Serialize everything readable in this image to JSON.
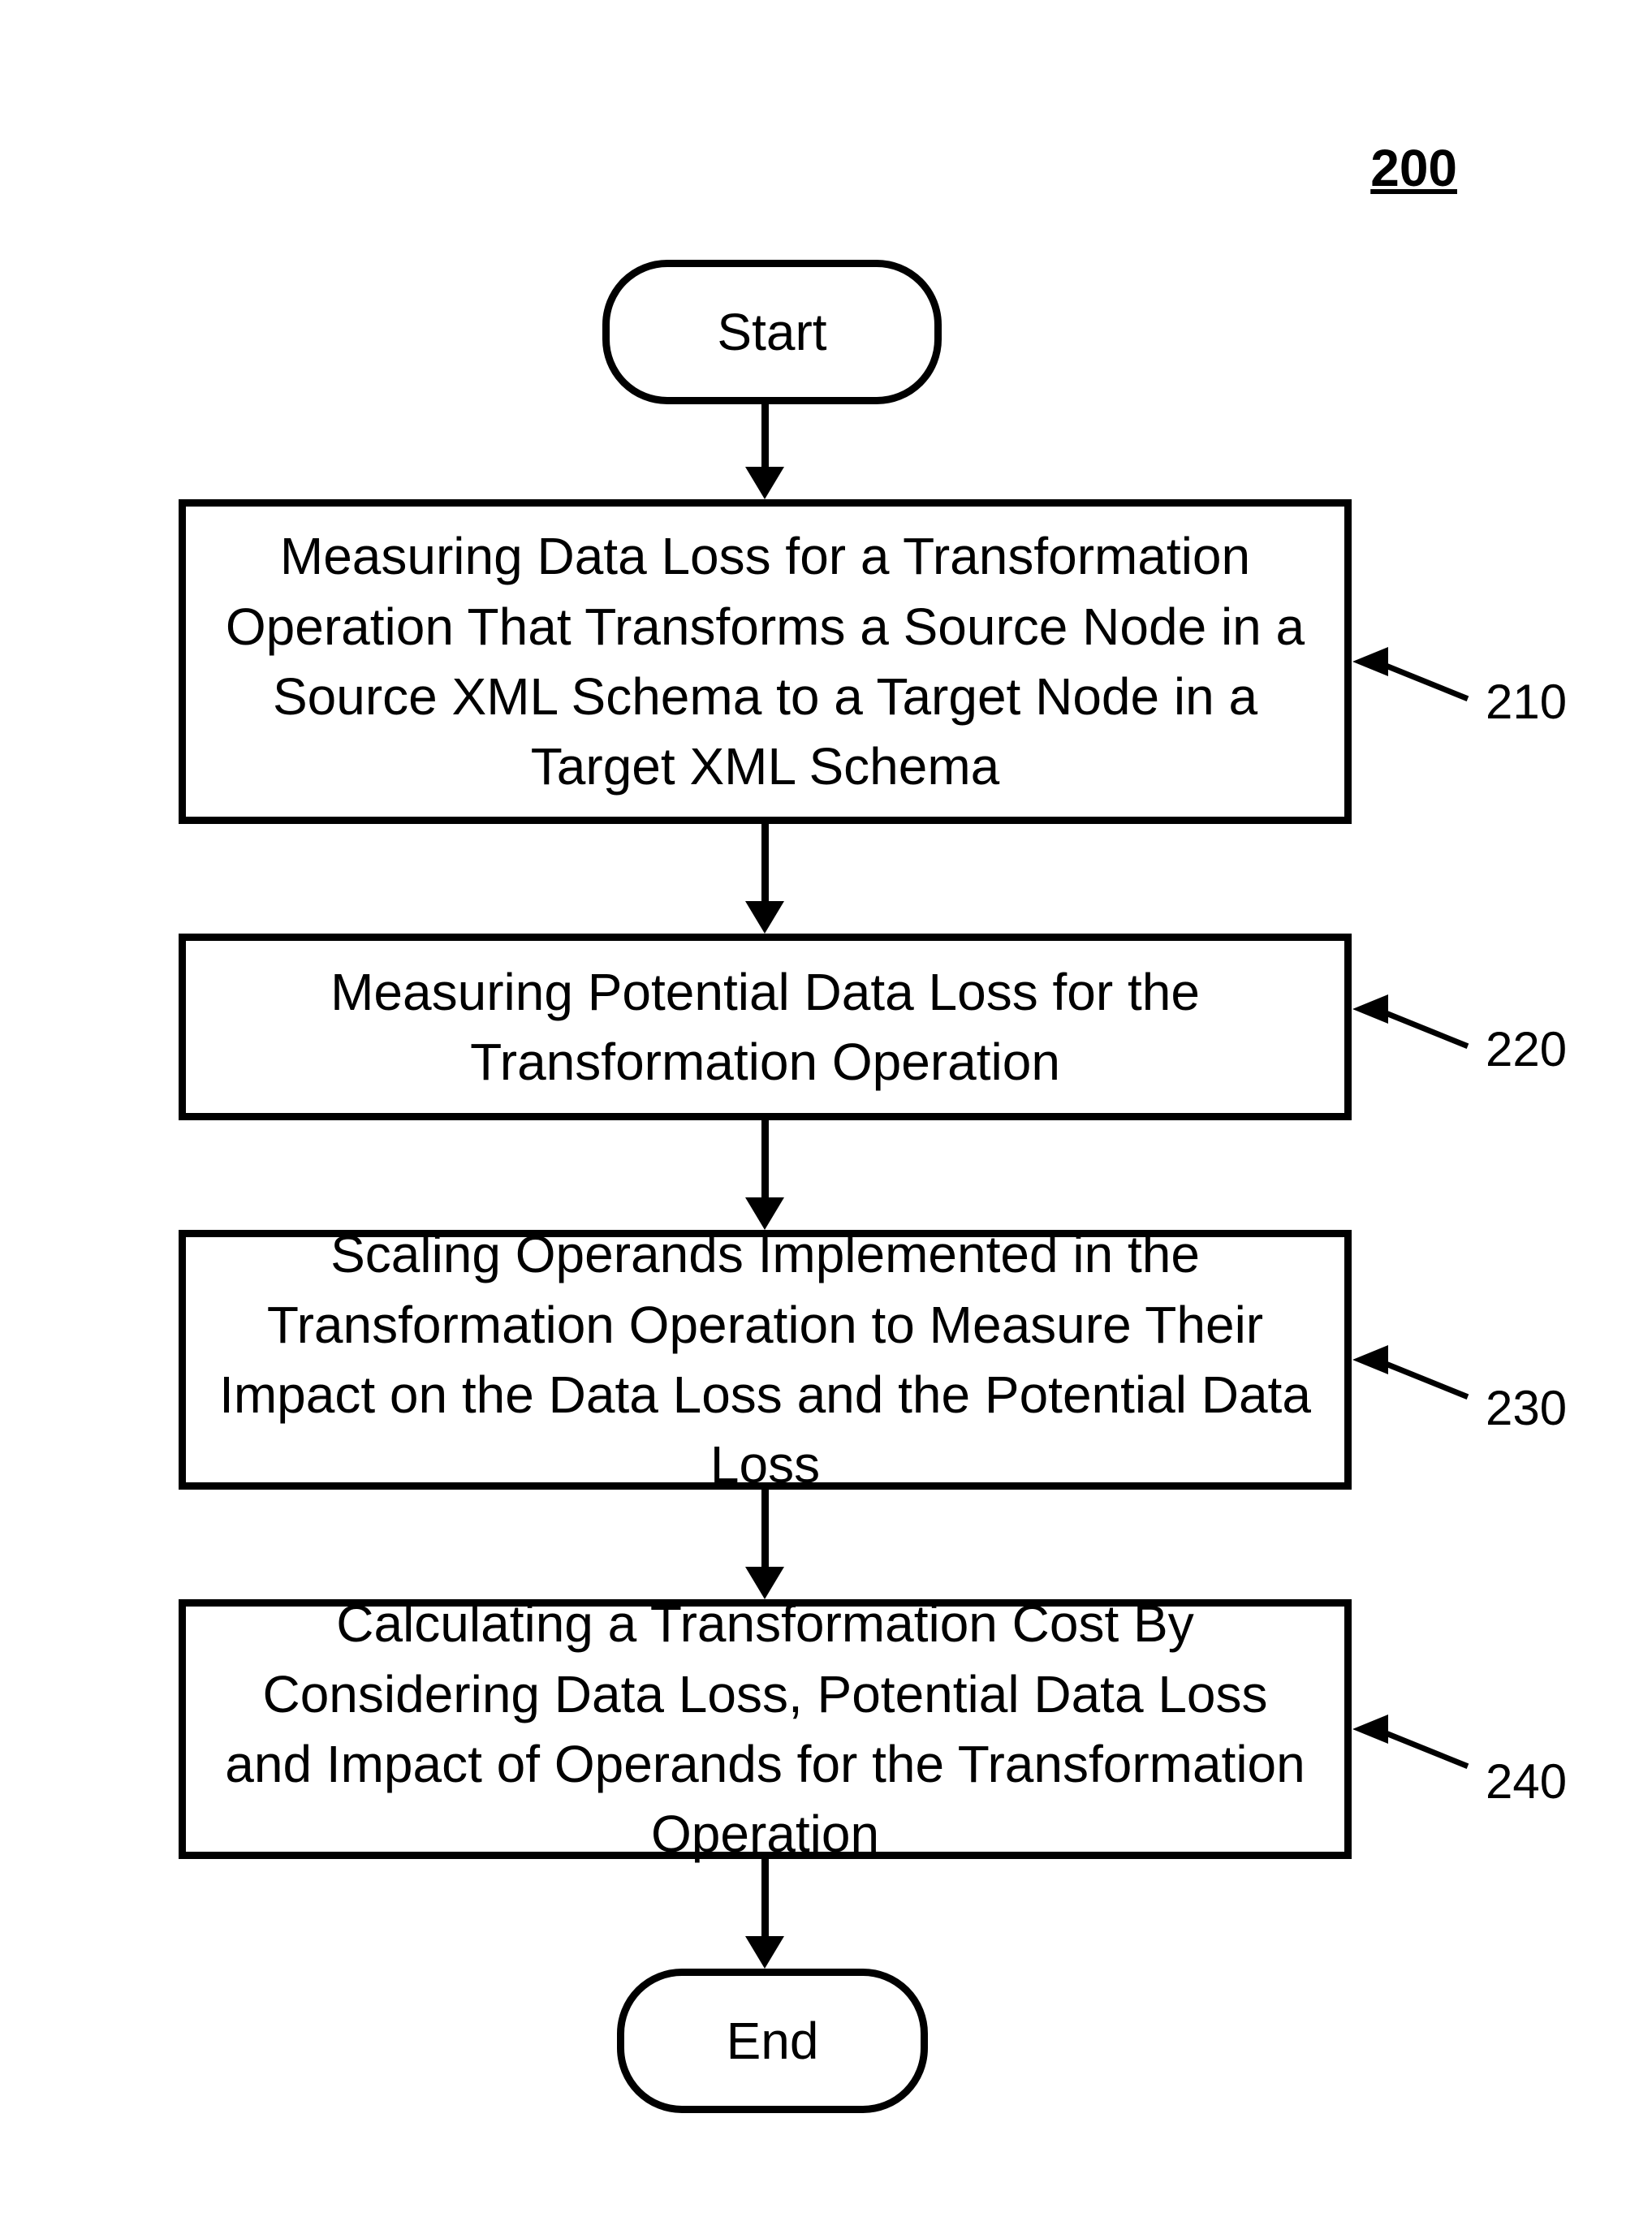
{
  "figure_number": "200",
  "terminator_start": "Start",
  "terminator_end": "End",
  "steps": {
    "s210": {
      "text": "Measuring Data Loss for a Transformation Operation That Transforms a Source Node in a Source XML Schema to a Target Node in a Target XML Schema",
      "label": "210"
    },
    "s220": {
      "text": "Measuring Potential Data Loss for the Transformation Operation",
      "label": "220"
    },
    "s230": {
      "text": "Scaling Operands Implemented in the Transformation Operation to Measure Their Impact on the Data Loss and the Potential Data Loss",
      "label": "230"
    },
    "s240": {
      "text": "Calculating a Transformation Cost By Considering Data Loss, Potential Data Loss and Impact of Operands for the Transformation Operation",
      "label": "240"
    }
  }
}
